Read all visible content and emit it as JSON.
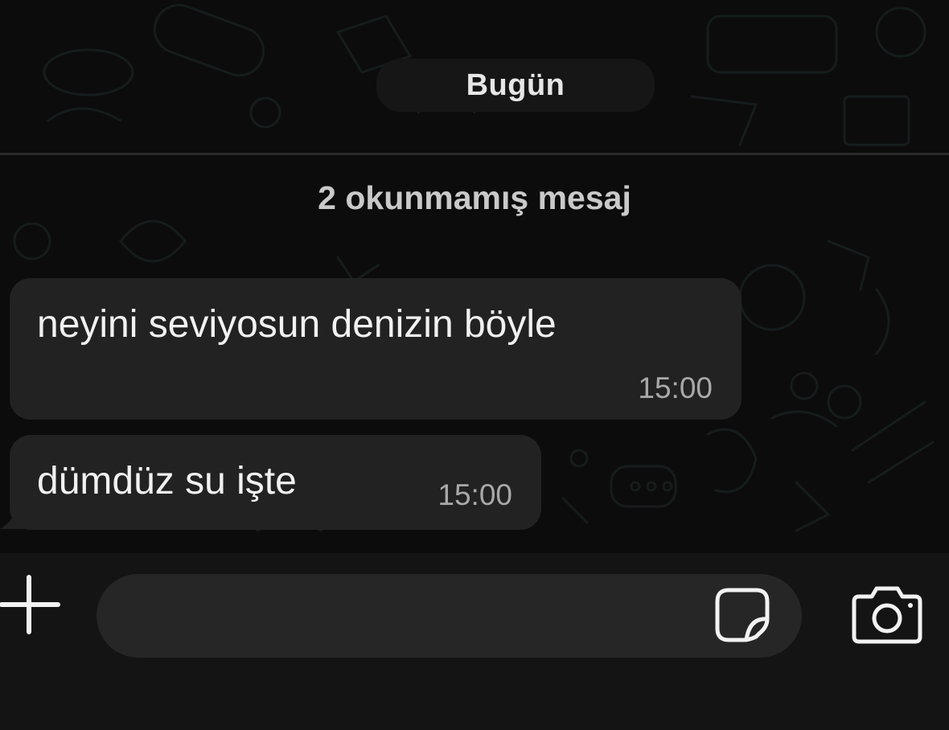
{
  "chat": {
    "date_chip": "Bugün",
    "unread_banner": "2 okunmamış mesaj",
    "messages": [
      {
        "text": "neyini seviyosun denizin böyle",
        "time": "15:00",
        "direction": "incoming"
      },
      {
        "text": "dümdüz su işte",
        "time": "15:00",
        "direction": "incoming"
      }
    ]
  },
  "composer": {
    "input_value": "",
    "icons": {
      "attach": "plus-icon",
      "sticker": "sticker-icon",
      "camera": "camera-icon"
    }
  },
  "colors": {
    "background": "#0c0c0c",
    "bubble_incoming": "#222222",
    "composer_bar": "#141414",
    "input_field": "#262626"
  }
}
